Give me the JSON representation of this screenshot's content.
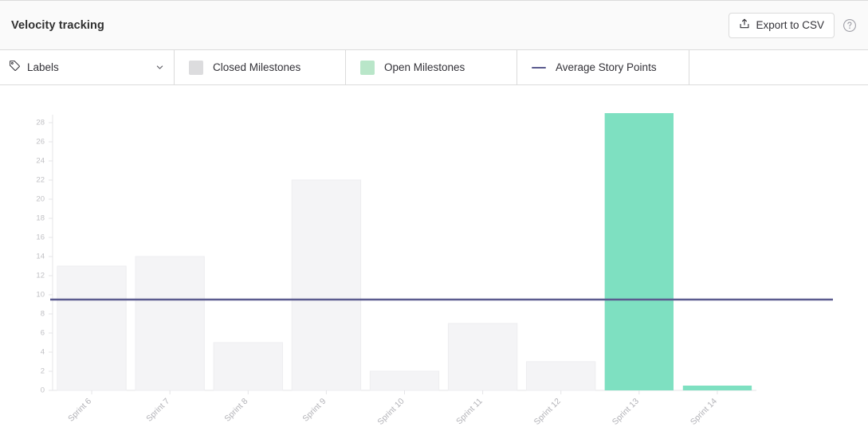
{
  "header": {
    "title": "Velocity tracking",
    "export_label": "Export to CSV",
    "export_icon": "export-upload-icon",
    "help_icon": "question-circle-icon"
  },
  "filter_bar": {
    "labels_dropdown": {
      "label": "Labels",
      "icon": "tag-icon",
      "chevron_icon": "chevron-down-icon"
    },
    "legend": [
      {
        "label": "Closed Milestones",
        "swatch_type": "square",
        "color": "#dcdcde"
      },
      {
        "label": "Open Milestones",
        "swatch_type": "square",
        "color": "#b9e6c9"
      },
      {
        "label": "Average Story Points",
        "swatch_type": "line",
        "color": "#5b5b8f"
      }
    ]
  },
  "colors": {
    "bar_closed": "#f4f4f6",
    "bar_open": "#7ee0c1",
    "average_line": "#5b5b8f",
    "axis": "#e4e4e7",
    "tick_text": "#bfbfc3",
    "panel_border": "#dbdbdb",
    "header_bg": "#fafafa"
  },
  "chart_data": {
    "type": "bar",
    "title": "Velocity tracking",
    "xlabel": "",
    "ylabel": "",
    "ylim": [
      0,
      29
    ],
    "yticks": [
      0,
      2,
      4,
      6,
      8,
      10,
      12,
      14,
      16,
      18,
      20,
      22,
      24,
      26,
      28
    ],
    "grid": false,
    "legend_position": "top",
    "categories": [
      "Sprint 6",
      "Sprint 7",
      "Sprint 8",
      "Sprint 9",
      "Sprint 10",
      "Sprint 11",
      "Sprint 12",
      "Sprint 13",
      "Sprint 14"
    ],
    "series": [
      {
        "name": "Closed Milestones",
        "color": "#f4f4f6",
        "values": [
          13,
          14,
          5,
          22,
          2,
          7,
          3,
          null,
          null
        ]
      },
      {
        "name": "Open Milestones",
        "color": "#7ee0c1",
        "values": [
          null,
          null,
          null,
          null,
          null,
          null,
          null,
          29,
          0.5
        ]
      }
    ],
    "reference_lines": [
      {
        "name": "Average Story Points",
        "value": 9.5,
        "color": "#5b5b8f",
        "orientation": "horizontal"
      }
    ]
  }
}
